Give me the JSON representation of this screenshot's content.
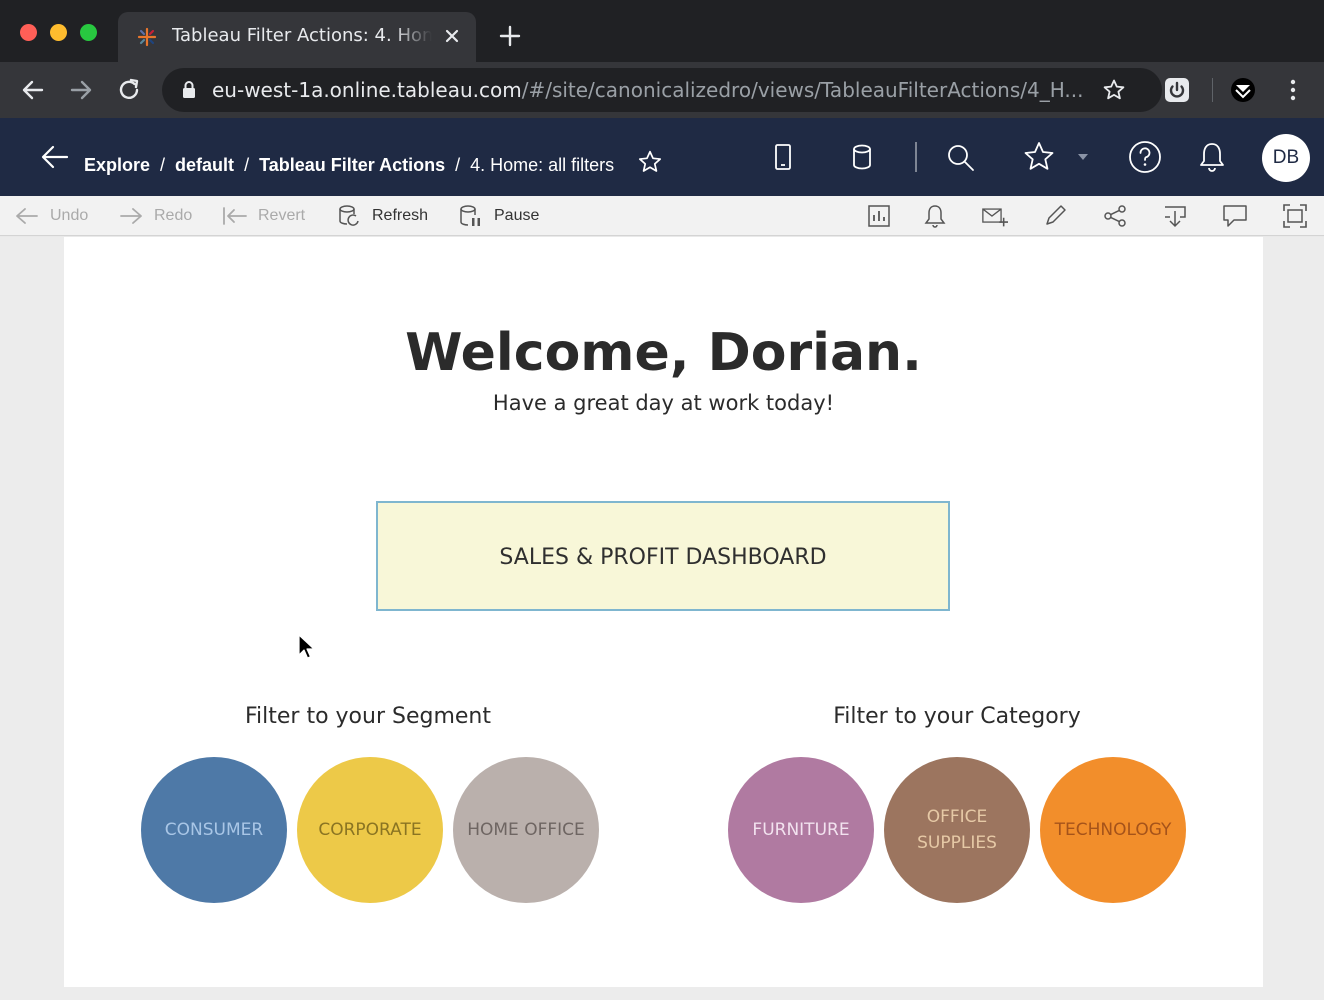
{
  "browser": {
    "tab_title": "Tableau Filter Actions: 4. Home: all filters",
    "url_host": "eu-west-1a.online.tableau.com",
    "url_path": "/#/site/canonicalizedro/views/TableauFilterActions/4_H..."
  },
  "tableau_header": {
    "breadcrumbs": [
      "Explore",
      "default",
      "Tableau Filter Actions",
      "4. Home: all filters"
    ],
    "avatar_initials": "DB"
  },
  "toolbar": {
    "undo": "Undo",
    "redo": "Redo",
    "revert": "Revert",
    "refresh": "Refresh",
    "pause": "Pause"
  },
  "dashboard": {
    "welcome": "Welcome, Dorian.",
    "subtitle": "Have a great day at work today!",
    "dashboard_button": "SALES & PROFIT DASHBOARD",
    "segment": {
      "title": "Filter to your Segment",
      "items": [
        {
          "label": "CONSUMER",
          "color": "#4e79a7",
          "text_color": "#a9c6e6"
        },
        {
          "label": "CORPORATE",
          "color": "#edc948",
          "text_color": "#8a7422"
        },
        {
          "label": "HOME OFFICE",
          "color": "#bab0ac",
          "text_color": "#6e6562"
        }
      ]
    },
    "category": {
      "title": "Filter to your Category",
      "items": [
        {
          "label": "FURNITURE",
          "color": "#b07aa1",
          "text_color": "#f2e2ef"
        },
        {
          "label": "OFFICE SUPPLIES",
          "line1": "OFFICE",
          "line2": "SUPPLIES",
          "color": "#9c755f",
          "text_color": "#e6c9a6"
        },
        {
          "label": "TECHNOLOGY",
          "color": "#f28e2b",
          "text_color": "#a5531a"
        }
      ]
    }
  }
}
